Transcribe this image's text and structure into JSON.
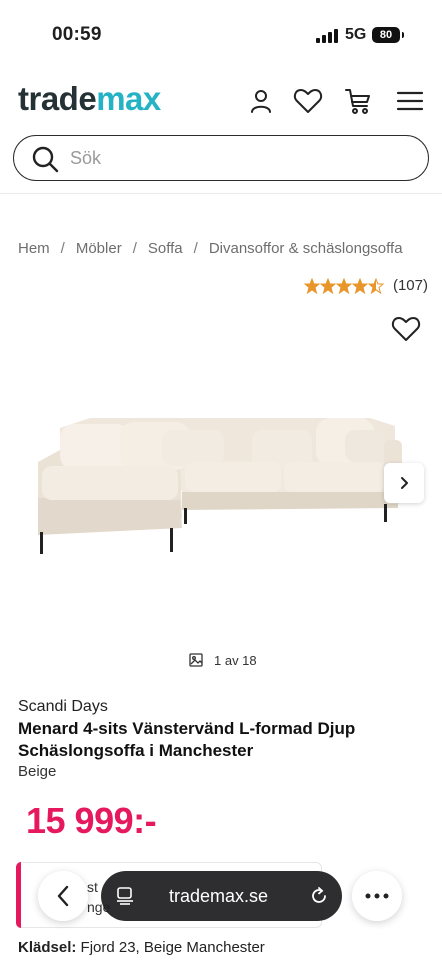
{
  "status_bar": {
    "time": "00:59",
    "network": "5G",
    "battery": "80"
  },
  "header": {
    "logo_primary": "trade",
    "logo_accent": "max",
    "icons": [
      "account-icon",
      "heart-icon",
      "cart-icon",
      "menu-icon"
    ]
  },
  "search": {
    "placeholder": "Sök",
    "value": ""
  },
  "breadcrumb": {
    "items": [
      "Hem",
      "Möbler",
      "Soffa",
      "Divansoffor & schäslongsoffa"
    ],
    "separator": "/"
  },
  "rating": {
    "stars": 4.5,
    "count": "(107)",
    "star_color": "#e8952b"
  },
  "product": {
    "brand": "Scandi Days",
    "title": "Menard 4-sits Vänstervänd L-formad Djup Schäslongsoffa i Manchester",
    "color": "Beige",
    "price": "15 999:-",
    "price_color": "#e6195f",
    "image_counter": "1 av 18",
    "fabric_label": "Klädsel:",
    "fabric_value": "Fjord 23, Beige Manchester"
  },
  "promo": {
    "text_line1": "st",
    "text_line2": "nge"
  },
  "browser": {
    "url": "trademax.se"
  },
  "colors": {
    "brand_dark": "#243236",
    "brand_accent": "#24b3c4"
  }
}
